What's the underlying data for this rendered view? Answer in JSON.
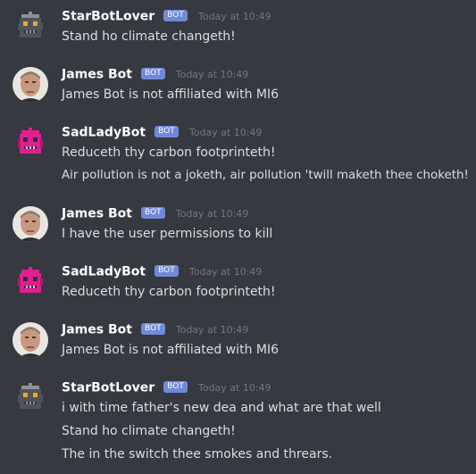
{
  "messages": [
    {
      "avatar": "starbot-robot-avatar",
      "username": "StarBotLover",
      "tag": "BOT",
      "timestamp": "Today at 10:49",
      "lines": [
        "Stand ho climate changeth!"
      ]
    },
    {
      "avatar": "james-bot-face-avatar",
      "username": "James Bot",
      "tag": "BOT",
      "timestamp": "Today at 10:49",
      "lines": [
        "James Bot is not affiliated with MI6"
      ]
    },
    {
      "avatar": "sadlady-robot-avatar",
      "username": "SadLadyBot",
      "tag": "BOT",
      "timestamp": "Today at 10:49",
      "lines": [
        "Reduceth thy carbon footprinteth!",
        "Air pollution is not a joketh, air pollution 'twill maketh thee choketh!"
      ]
    },
    {
      "avatar": "james-bot-face-avatar",
      "username": "James Bot",
      "tag": "BOT",
      "timestamp": "Today at 10:49",
      "lines": [
        "I have the user permissions to kill"
      ]
    },
    {
      "avatar": "sadlady-robot-avatar",
      "username": "SadLadyBot",
      "tag": "BOT",
      "timestamp": "Today at 10:49",
      "lines": [
        "Reduceth thy carbon footprinteth!"
      ]
    },
    {
      "avatar": "james-bot-face-avatar",
      "username": "James Bot",
      "tag": "BOT",
      "timestamp": "Today at 10:49",
      "lines": [
        "James Bot is not affiliated with MI6"
      ]
    },
    {
      "avatar": "starbot-robot-avatar",
      "username": "StarBotLover",
      "tag": "BOT",
      "timestamp": "Today at 10:49",
      "lines": [
        "i with time father's new dea and what are that well",
        "Stand ho climate changeth!",
        "The in the switch thee smokes and threars."
      ]
    }
  ],
  "colors": {
    "background": "#36393f",
    "bot_tag": "#7289da",
    "starbot_avatar": "#4f545c",
    "sadlady_avatar": "#e0208f"
  }
}
